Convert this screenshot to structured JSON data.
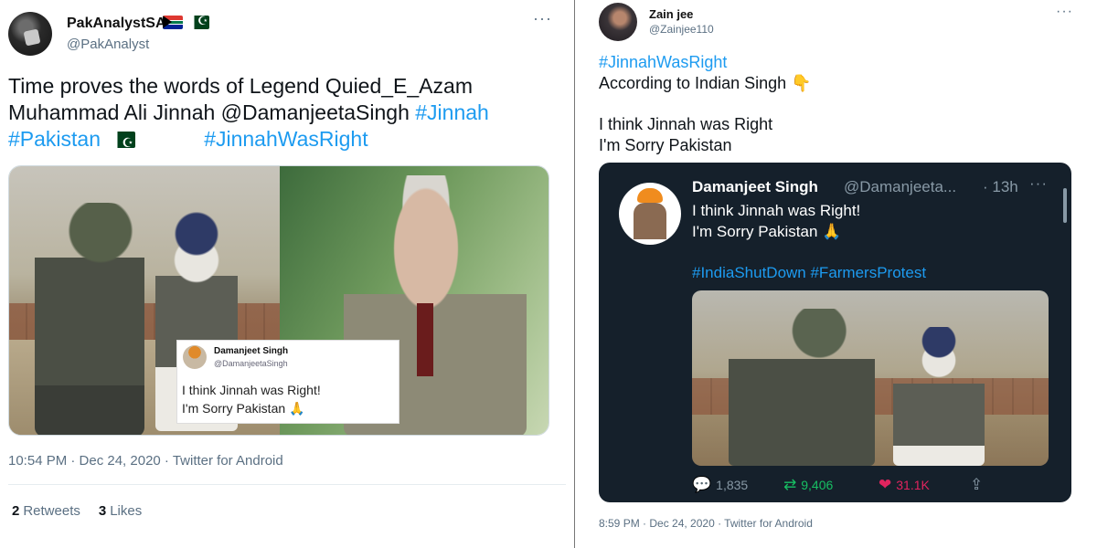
{
  "left_tweet": {
    "author_name": "PakAnalystSA",
    "author_handle": "@PakAnalyst",
    "body_text": "Time proves the words of Legend Quied_E_Azam Muhammad Ali Jinnah @DamanjeetaSingh",
    "hashtag_1": "#Jinnah",
    "hashtag_2": "#Pakistan",
    "hashtag_3": "#JinnahWasRight",
    "more_glyph": "···",
    "inset": {
      "name": "Damanjeet Singh",
      "handle": "@DamanjeetaSingh",
      "line1": "I think Jinnah was Right!",
      "line2": "I'm Sorry Pakistan 🙏"
    },
    "timestamp": "10:54 PM · Dec 24, 2020 · Twitter for Android",
    "retweets_count": "2",
    "retweets_label": "Retweets",
    "likes_count": "3",
    "likes_label": "Likes"
  },
  "right_tweet": {
    "author_name": "Zain jee",
    "author_handle": "@Zainjee110",
    "more_glyph": "···",
    "hashtag": "#JinnahWasRight",
    "line1": "According to Indian Singh 👇",
    "line2": "I think Jinnah was Right",
    "line3": "I'm Sorry Pakistan",
    "quoted": {
      "name": "Damanjeet Singh",
      "handle": "@Damanjeeta...",
      "time": "· 13h",
      "more_glyph": "···",
      "text_1": "I think Jinnah was Right!",
      "text_2": "I'm Sorry Pakistan 🙏",
      "hashtags": "#IndiaShutDown #FarmersProtest",
      "replies": "1,835",
      "retweets": "9,406",
      "likes": "31.1K"
    },
    "timestamp": "8:59 PM · Dec 24, 2020 · Twitter for Android"
  },
  "colors": {
    "link_blue": "#1d9bf0",
    "dark_card": "#15202b",
    "retweet_green": "#17bf63",
    "like_pink": "#e0245e"
  },
  "icons": [
    "south-africa-flag-icon",
    "pakistan-flag-icon",
    "reply-icon",
    "retweet-icon",
    "heart-icon",
    "share-icon"
  ]
}
